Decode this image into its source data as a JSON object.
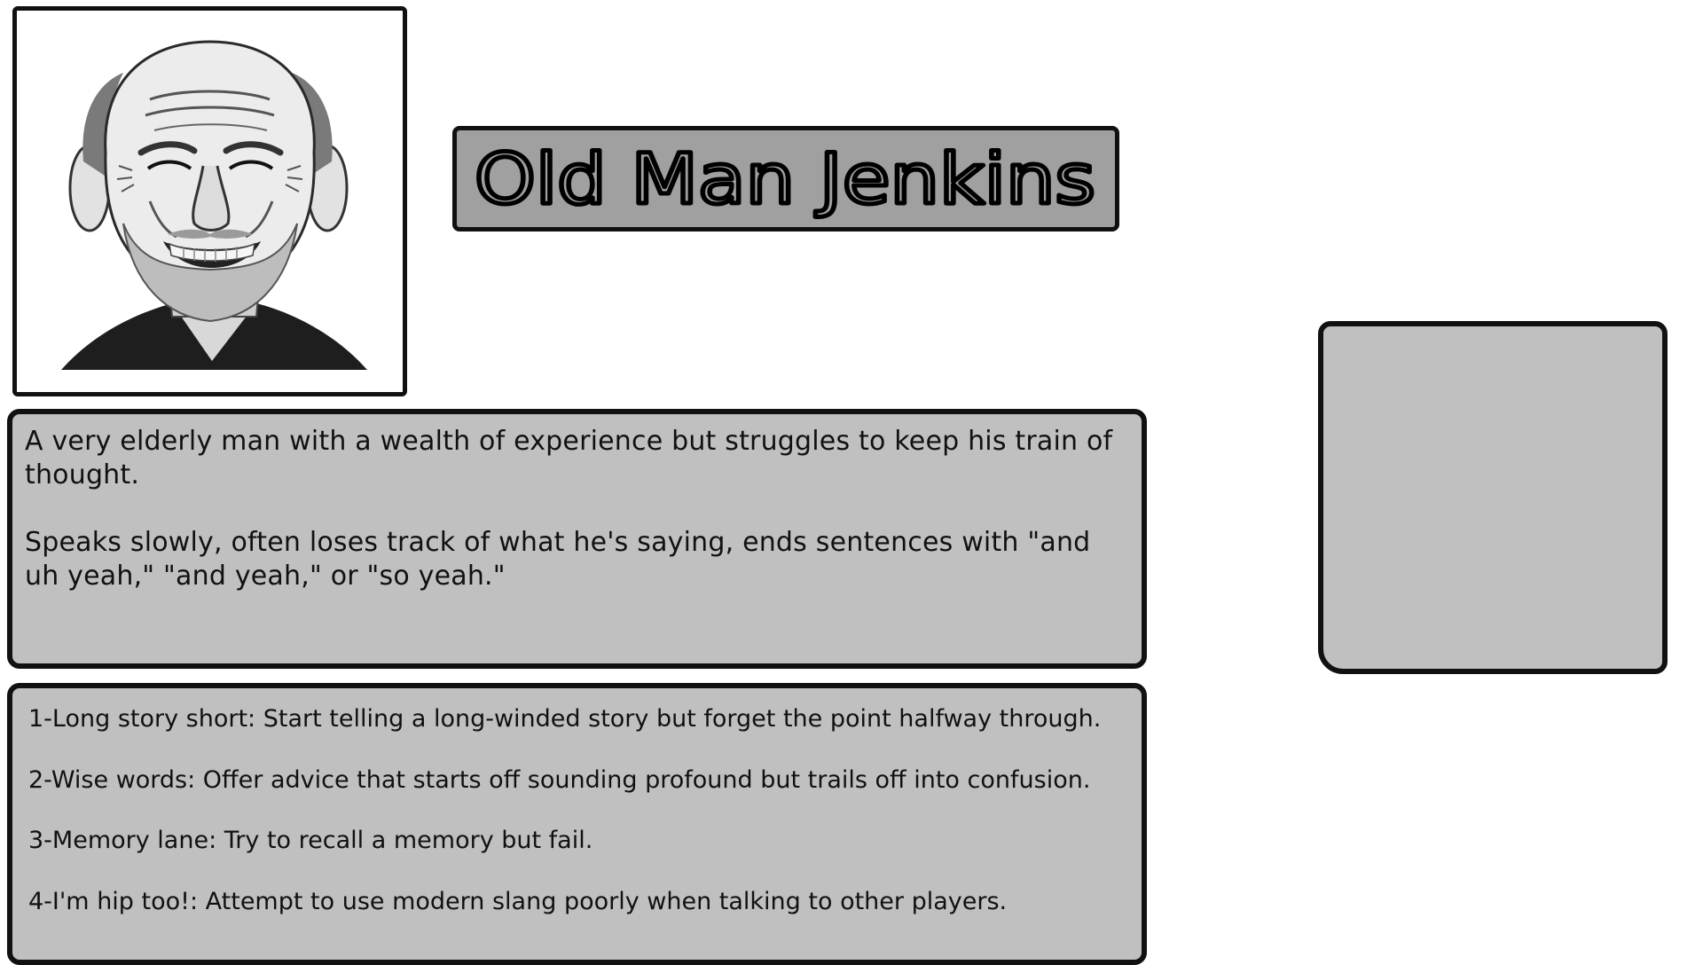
{
  "character": {
    "name": "Old Man Jenkins",
    "portrait_icon": "smiling-old-man-portrait",
    "description": [
      "A very elderly man with a wealth of experience but struggles to keep his train of thought.",
      "Speaks slowly, often loses track of what he's saying, ends sentences with \"and uh yeah,\" \"and yeah,\" or \"so yeah.\""
    ],
    "moves": [
      "1-Long story short: Start telling a long-winded story but forget the point halfway through.",
      "2-Wise words: Offer advice that starts off sounding profound but trails off into confusion.",
      "3-Memory lane: Try to recall a memory but fail.",
      "4-I'm hip too!: Attempt to use modern slang poorly when talking to other players."
    ]
  },
  "colors": {
    "box_fill": "#c0c0c0",
    "banner_fill": "#a0a0a0",
    "border": "#111111"
  }
}
